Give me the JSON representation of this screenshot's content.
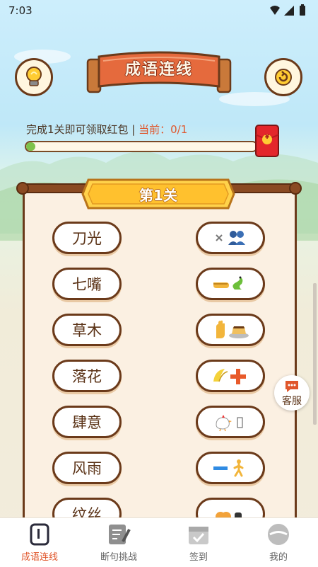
{
  "status_bar": {
    "time": "7:03"
  },
  "header": {
    "title": "成语连线"
  },
  "progress": {
    "prefix": "完成1关即可领取红包 | ",
    "current_label": "当前：0/1",
    "fraction": 0.04,
    "redpack_symbol": "¥"
  },
  "level": {
    "title": "第1关"
  },
  "left_words": [
    "刀光",
    "七嘴",
    "草木",
    "落花",
    "肆意",
    "风雨",
    "纹丝"
  ],
  "right_items": [
    "sword-people",
    "hand-snake",
    "hand-pudding",
    "banana-plus",
    "chicken-box",
    "line-walker",
    "partial"
  ],
  "service": {
    "label": "客服"
  },
  "tabs": [
    {
      "label": "成语连线",
      "icon": "idiom-card-icon",
      "active": true
    },
    {
      "label": "断句挑战",
      "icon": "notebook-pen-icon",
      "active": false
    },
    {
      "label": "签到",
      "icon": "calendar-check-icon",
      "active": false
    },
    {
      "label": "我的",
      "icon": "profile-icon",
      "active": false
    }
  ],
  "colors": {
    "accent": "#e0562b",
    "brown": "#6b3a1a",
    "progress": "#7ec24a"
  }
}
